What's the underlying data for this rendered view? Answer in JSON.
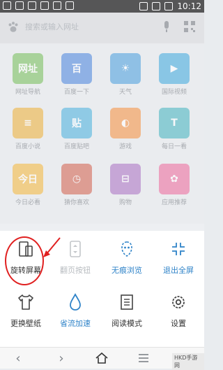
{
  "status_bar": {
    "time": "10:12"
  },
  "search": {
    "placeholder": "搜索或输入网址"
  },
  "apps": [
    {
      "label": "网址导航",
      "glyph": "网址",
      "color": "#5db33d"
    },
    {
      "label": "百度一下",
      "glyph": "百",
      "color": "#2a6fd6"
    },
    {
      "label": "天气",
      "glyph": "☀",
      "color": "#2a8fd6"
    },
    {
      "label": "国际视频",
      "glyph": "▶",
      "color": "#1e9bd6"
    },
    {
      "label": "百度小说",
      "glyph": "≡",
      "color": "#e8a317"
    },
    {
      "label": "百度贴吧",
      "glyph": "贴",
      "color": "#2aa3d6"
    },
    {
      "label": "游戏",
      "glyph": "◐",
      "color": "#f27d1e"
    },
    {
      "label": "每日一看",
      "glyph": "T",
      "color": "#24a7b2"
    },
    {
      "label": "今日必看",
      "glyph": "今日",
      "color": "#f1a91b"
    },
    {
      "label": "猜你喜欢",
      "glyph": "◷",
      "color": "#c9462f"
    },
    {
      "label": "购物",
      "glyph": "⊟",
      "color": "#9b59b6"
    },
    {
      "label": "应用推荐",
      "glyph": "✿",
      "color": "#e8508a"
    }
  ],
  "menu": {
    "items": [
      {
        "label": "旋转屏幕",
        "style": "normal"
      },
      {
        "label": "翻页按钮",
        "style": "disabled"
      },
      {
        "label": "无痕浏览",
        "style": "blue"
      },
      {
        "label": "退出全屏",
        "style": "blue"
      },
      {
        "label": "更换壁纸",
        "style": "normal"
      },
      {
        "label": "省流加速",
        "style": "blue"
      },
      {
        "label": "阅读模式",
        "style": "normal"
      },
      {
        "label": "设置",
        "style": "normal"
      }
    ]
  },
  "nav": {
    "tab_count": "1"
  },
  "watermark": "HKD手游网"
}
